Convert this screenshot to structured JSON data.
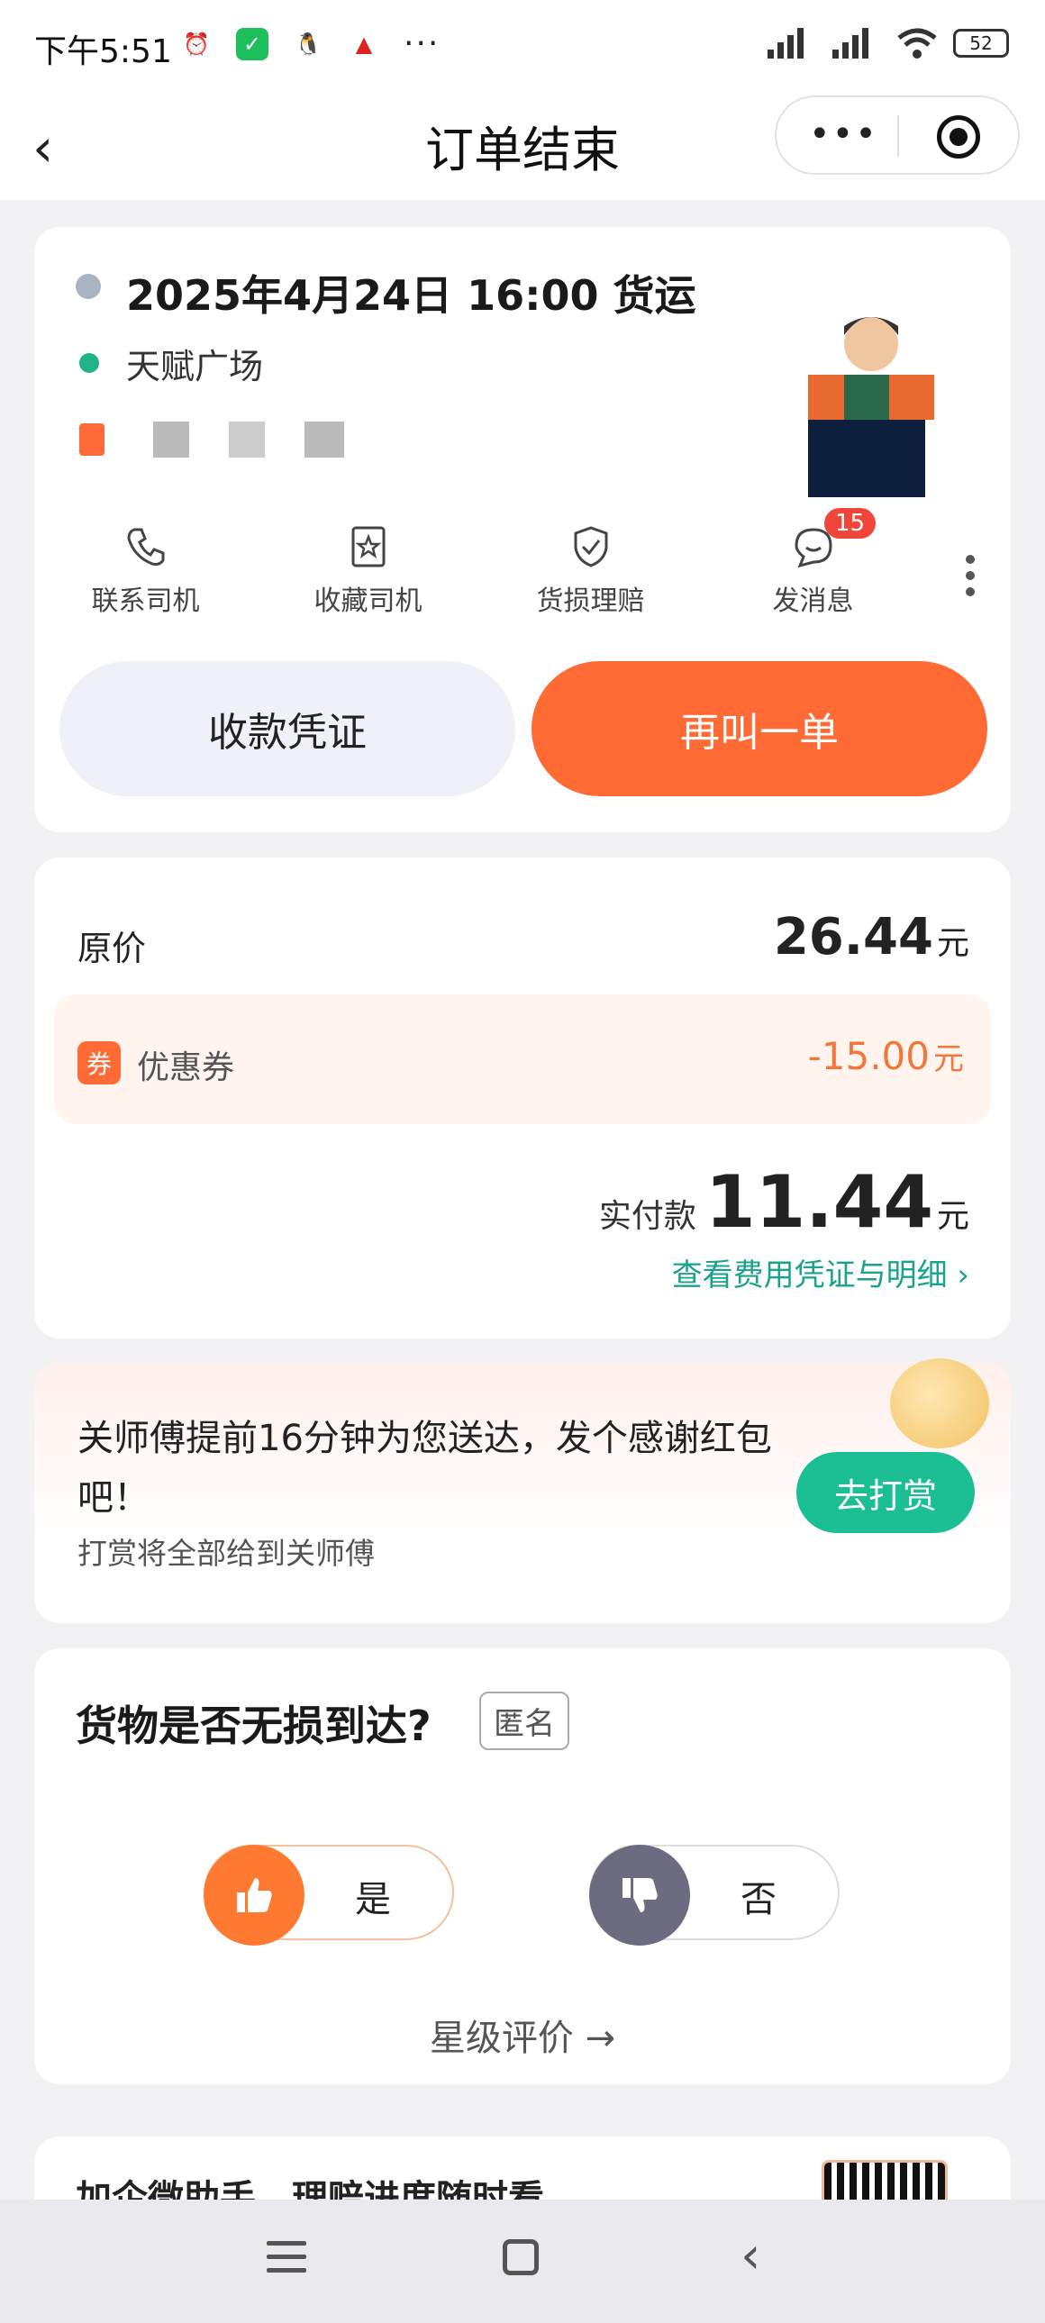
{
  "status_bar": {
    "time": "下午5:51",
    "dots": "···",
    "battery": "52"
  },
  "nav": {
    "title": "订单结束",
    "capsule_dots": "•••"
  },
  "order": {
    "datetime": "2025年4月24日 16:00 货运",
    "place": "天赋广场",
    "actions": [
      {
        "label": "联系司机",
        "icon": "phone-icon"
      },
      {
        "label": "收藏司机",
        "icon": "star-bookmark-icon"
      },
      {
        "label": "货损理赔",
        "icon": "shield-check-icon"
      },
      {
        "label": "发消息",
        "icon": "chat-bubble-icon",
        "badge": "15"
      }
    ],
    "receipt_button": "收款凭证",
    "reorder_button": "再叫一单"
  },
  "price": {
    "original_label": "原价",
    "original_value": "26.44",
    "currency": "元",
    "coupon_icon_text": "券",
    "coupon_label": "优惠券",
    "coupon_value": "-15.00",
    "paid_label": "实付款",
    "paid_value": "11.44",
    "detail_link": "查看费用凭证与明细 ›"
  },
  "tip": {
    "text": "关师傅提前16分钟为您送达，发个感谢红包吧！",
    "sub": "打赏将全部给到关师傅",
    "button": "去打赏"
  },
  "rating": {
    "question": "货物是否无损到达?",
    "anonymous": "匿名",
    "yes": "是",
    "no": "否",
    "star_link": "星级评价 →"
  },
  "wecom": {
    "text": "加企微助手，理赔进度随时看"
  },
  "colors": {
    "accent": "#ff6a35",
    "green": "#1cbf94",
    "link": "#1aa38c"
  }
}
